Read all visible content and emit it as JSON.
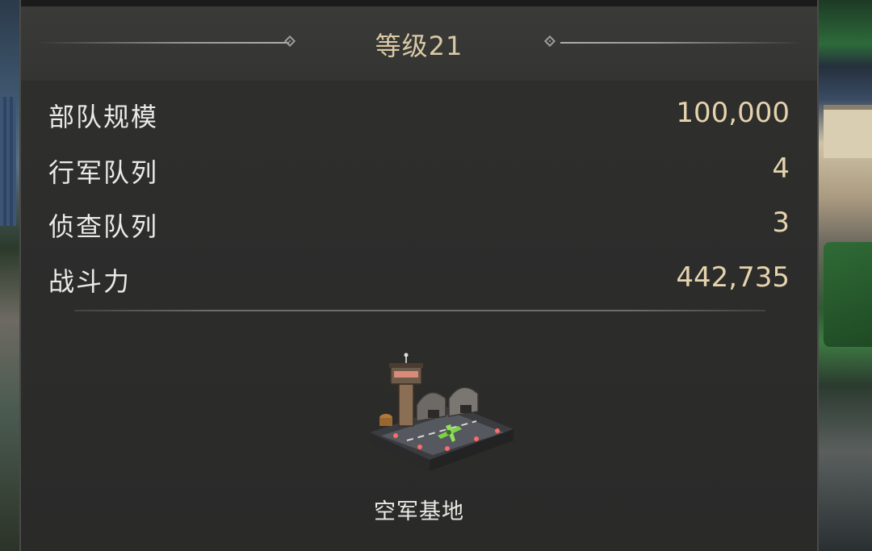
{
  "panel": {
    "title": "等级21"
  },
  "stats": [
    {
      "label": "部队规模",
      "value": "100,000"
    },
    {
      "label": "行军队列",
      "value": "4"
    },
    {
      "label": "侦查队列",
      "value": "3"
    },
    {
      "label": "战斗力",
      "value": "442,735"
    }
  ],
  "building": {
    "name": "空军基地",
    "icon": "air-base-building-icon"
  },
  "colors": {
    "title": "#d9c9a4",
    "value": "#e6d3ad",
    "label": "#eaeae6",
    "panel_bg": "#2a2a2a",
    "header_bg": "#3a3a39"
  }
}
